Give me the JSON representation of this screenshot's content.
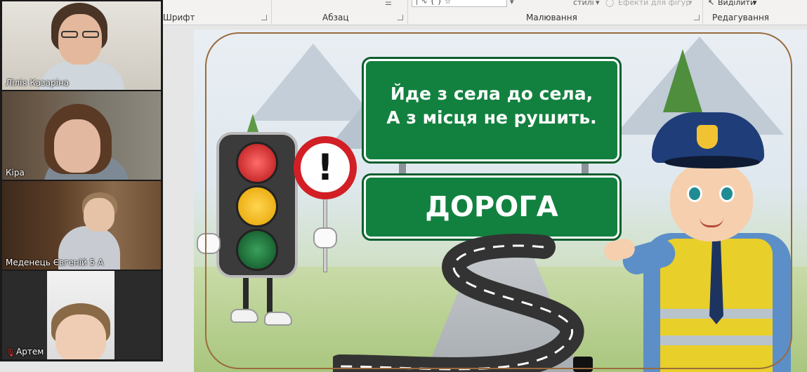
{
  "ribbon": {
    "font_group": "Шрифт",
    "paragraph_group": "Абзац",
    "drawing_group": "Малювання",
    "editing_group": "Редагування",
    "styles_label": "стилі",
    "shape_effects_label": "Ефекти для фігур",
    "select_label": "Виділити"
  },
  "slide": {
    "riddle_line1": "Йде з села до села,",
    "riddle_line2": "А з місця не рушить.",
    "answer": "ДОРОГА",
    "warning_mark": "!"
  },
  "participants": [
    {
      "name": "Лілія Казаріна",
      "active": true
    },
    {
      "name": "Кіра",
      "active": false
    },
    {
      "name": "Меденець Євгеній 5 А",
      "active": false
    },
    {
      "name": "Артем",
      "active": false,
      "muted": true
    }
  ],
  "colors": {
    "sign_green": "#12813f",
    "active_speaker": "#7ab84a",
    "muted_icon": "#e53935"
  }
}
